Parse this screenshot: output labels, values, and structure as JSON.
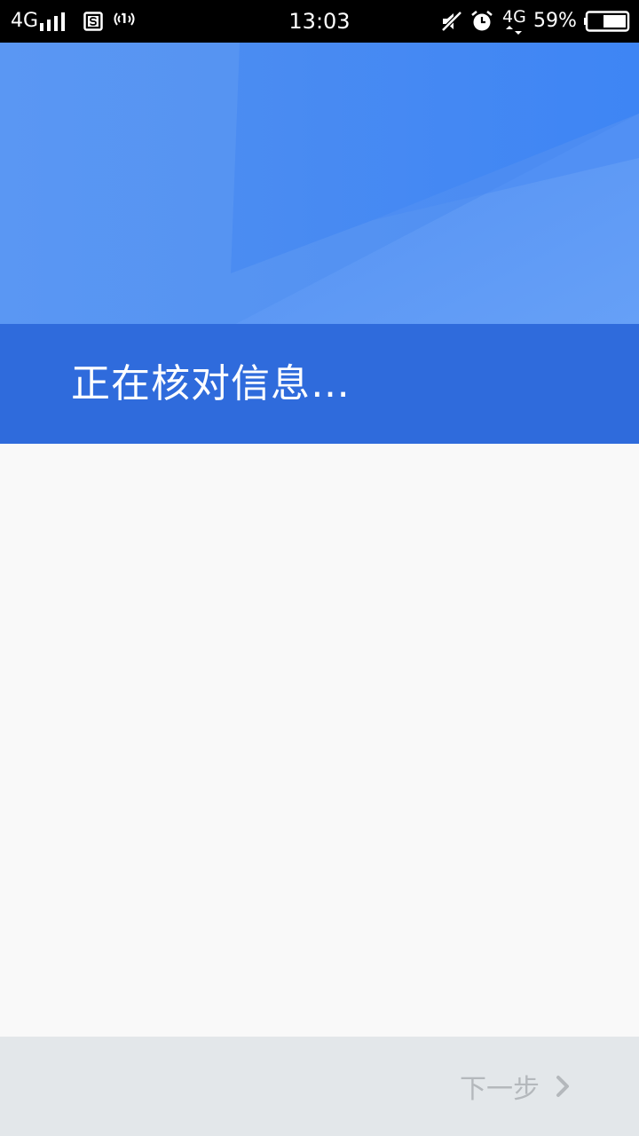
{
  "status_bar": {
    "network_left": "4G",
    "time": "13:03",
    "network_right": "4G",
    "battery_percent": "59%",
    "battery_level": 0.59,
    "icons": [
      "signal-bars-icon",
      "s-app-icon",
      "hotspot-icon",
      "mute-icon",
      "alarm-icon",
      "data-arrows-icon",
      "battery-icon"
    ]
  },
  "header": {
    "title": "正在核对信息…"
  },
  "bottom_bar": {
    "next_label": "下一步",
    "next_icon": "chevron-right-icon"
  },
  "colors": {
    "status_bar_bg": "#000000",
    "header_blue": "#4a8bf2",
    "header_band": "#2f6bdc",
    "content_bg": "#f9f9f9",
    "bottom_bar_bg": "#e3e7ea",
    "disabled_text": "#b4b8bc"
  }
}
